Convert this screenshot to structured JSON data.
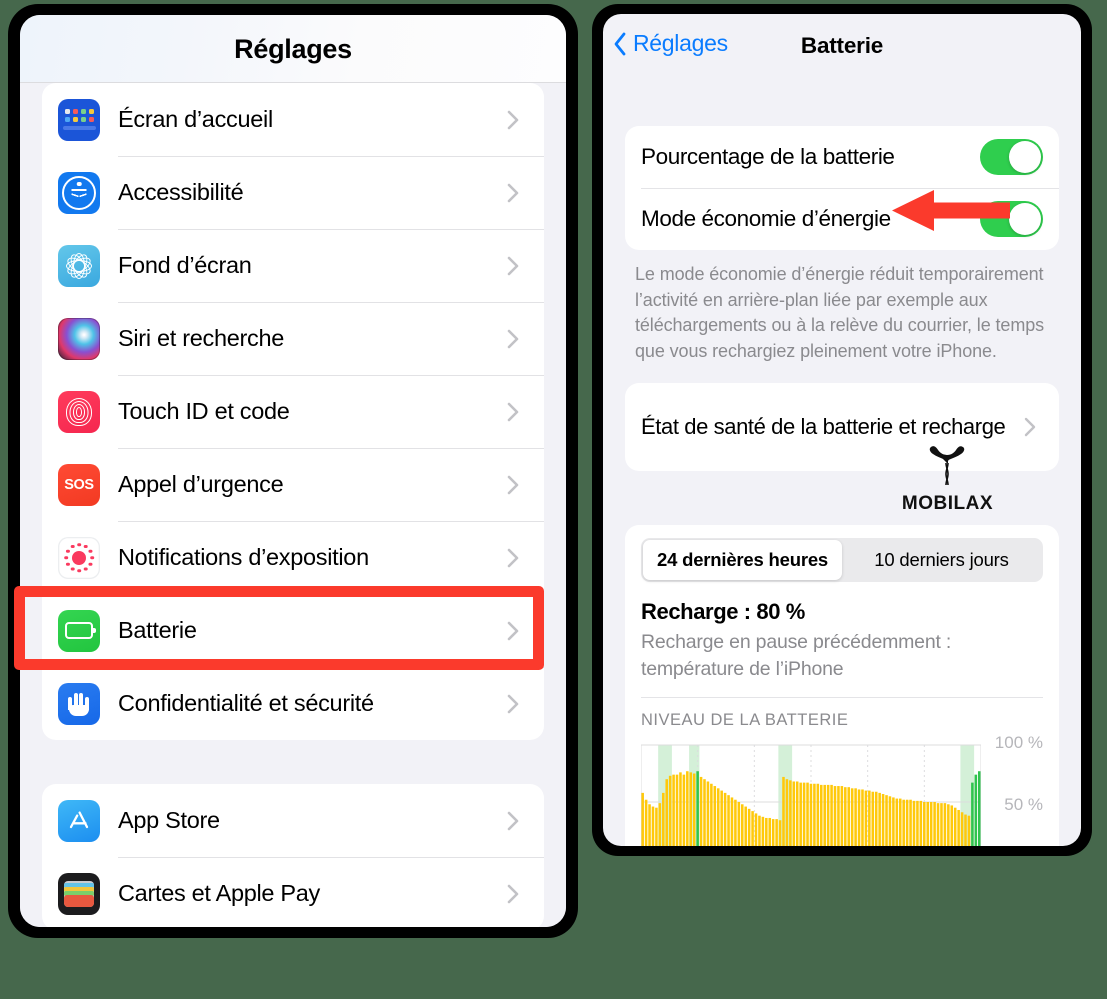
{
  "colors": {
    "accent_blue": "#0a7cff",
    "toggle_green": "#2fce4e",
    "highlight_red": "#fb3a2c",
    "battery_icon_green": "#2ac83f",
    "chart_yellow": "#ffc90b",
    "chart_green": "#30c44e",
    "page_background": "#46684c"
  },
  "left_panel": {
    "header_title": "Réglages",
    "groups": [
      {
        "items": [
          {
            "label": "Écran d’accueil",
            "icon": "home-screen-icon"
          },
          {
            "label": "Accessibilité",
            "icon": "accessibility-icon"
          },
          {
            "label": "Fond d’écran",
            "icon": "wallpaper-icon"
          },
          {
            "label": "Siri et recherche",
            "icon": "siri-icon"
          },
          {
            "label": "Touch ID et code",
            "icon": "touch-id-icon"
          },
          {
            "label": "Appel d’urgence",
            "icon": "sos-icon"
          },
          {
            "label": "Notifications d’exposition",
            "icon": "exposure-notifications-icon"
          },
          {
            "label": "Batterie",
            "icon": "battery-icon",
            "highlighted": true
          },
          {
            "label": "Confidentialité et sécurité",
            "icon": "privacy-icon"
          }
        ]
      },
      {
        "items": [
          {
            "label": "App Store",
            "icon": "app-store-icon"
          },
          {
            "label": "Cartes et Apple Pay",
            "icon": "wallet-icon"
          }
        ]
      }
    ]
  },
  "right_panel": {
    "back_label": "Réglages",
    "title": "Batterie",
    "toggles": [
      {
        "label": "Pourcentage de la batterie",
        "state": "on"
      },
      {
        "label": "Mode économie d’énergie",
        "state": "on"
      }
    ],
    "description": "Le mode économie d’énergie réduit temporairement l’activité en arrière-plan liée par exemple aux téléchargements ou à la relève du courrier, le temps que vous rechargiez pleinement votre iPhone.",
    "health_row": {
      "label": "État de santé de la batterie et recharge"
    },
    "watermark": "MOBILAX",
    "usage": {
      "segments": [
        {
          "label": "24 dernières heures",
          "selected": true
        },
        {
          "label": "10 derniers jours",
          "selected": false
        }
      ],
      "charge_label": "Recharge : 80 %",
      "charge_sub": "Recharge en pause précédemment : température de l’iPhone"
    }
  },
  "chart_data": {
    "type": "bar",
    "title": "NIVEAU DE LA BATTERIE",
    "xlabel": "",
    "ylabel": "",
    "ylim": [
      0,
      100
    ],
    "ytick_labels": [
      "100 %",
      "50 %"
    ],
    "ytick_values": [
      100,
      50
    ],
    "grid": true,
    "legend": null,
    "series": [
      {
        "name": "Niveau de la batterie",
        "color": "#ffc90b",
        "values": [
          58,
          52,
          48,
          46,
          45,
          49,
          58,
          70,
          73,
          74,
          74,
          76,
          74,
          77,
          76,
          75,
          73,
          72,
          70,
          68,
          66,
          64,
          62,
          60,
          58,
          56,
          54,
          52,
          50,
          48,
          46,
          44,
          42,
          40,
          38,
          37,
          36,
          36,
          35,
          35,
          34,
          72,
          70,
          69,
          68,
          68,
          67,
          67,
          67,
          66,
          66,
          66,
          65,
          65,
          65,
          65,
          64,
          64,
          64,
          63,
          63,
          62,
          62,
          61,
          61,
          60,
          60,
          59,
          59,
          58,
          57,
          56,
          55,
          54,
          53,
          53,
          52,
          52,
          52,
          51,
          51,
          51,
          50,
          50,
          50,
          50,
          49,
          49,
          49,
          48,
          47,
          45,
          43,
          41,
          39,
          38,
          50,
          74,
          77
        ]
      },
      {
        "name": "Périodes de recharge",
        "color": "#30c44e",
        "charging_bars": [
          {
            "index": 16,
            "value": 77
          },
          {
            "index": 96,
            "value": 67
          },
          {
            "index": 97,
            "value": 74
          },
          {
            "index": 98,
            "value": 77
          }
        ]
      }
    ],
    "charging_bands": [
      {
        "start": 5,
        "end": 9
      },
      {
        "start": 14,
        "end": 17
      },
      {
        "start": 40,
        "end": 44
      },
      {
        "start": 93,
        "end": 97
      }
    ]
  }
}
